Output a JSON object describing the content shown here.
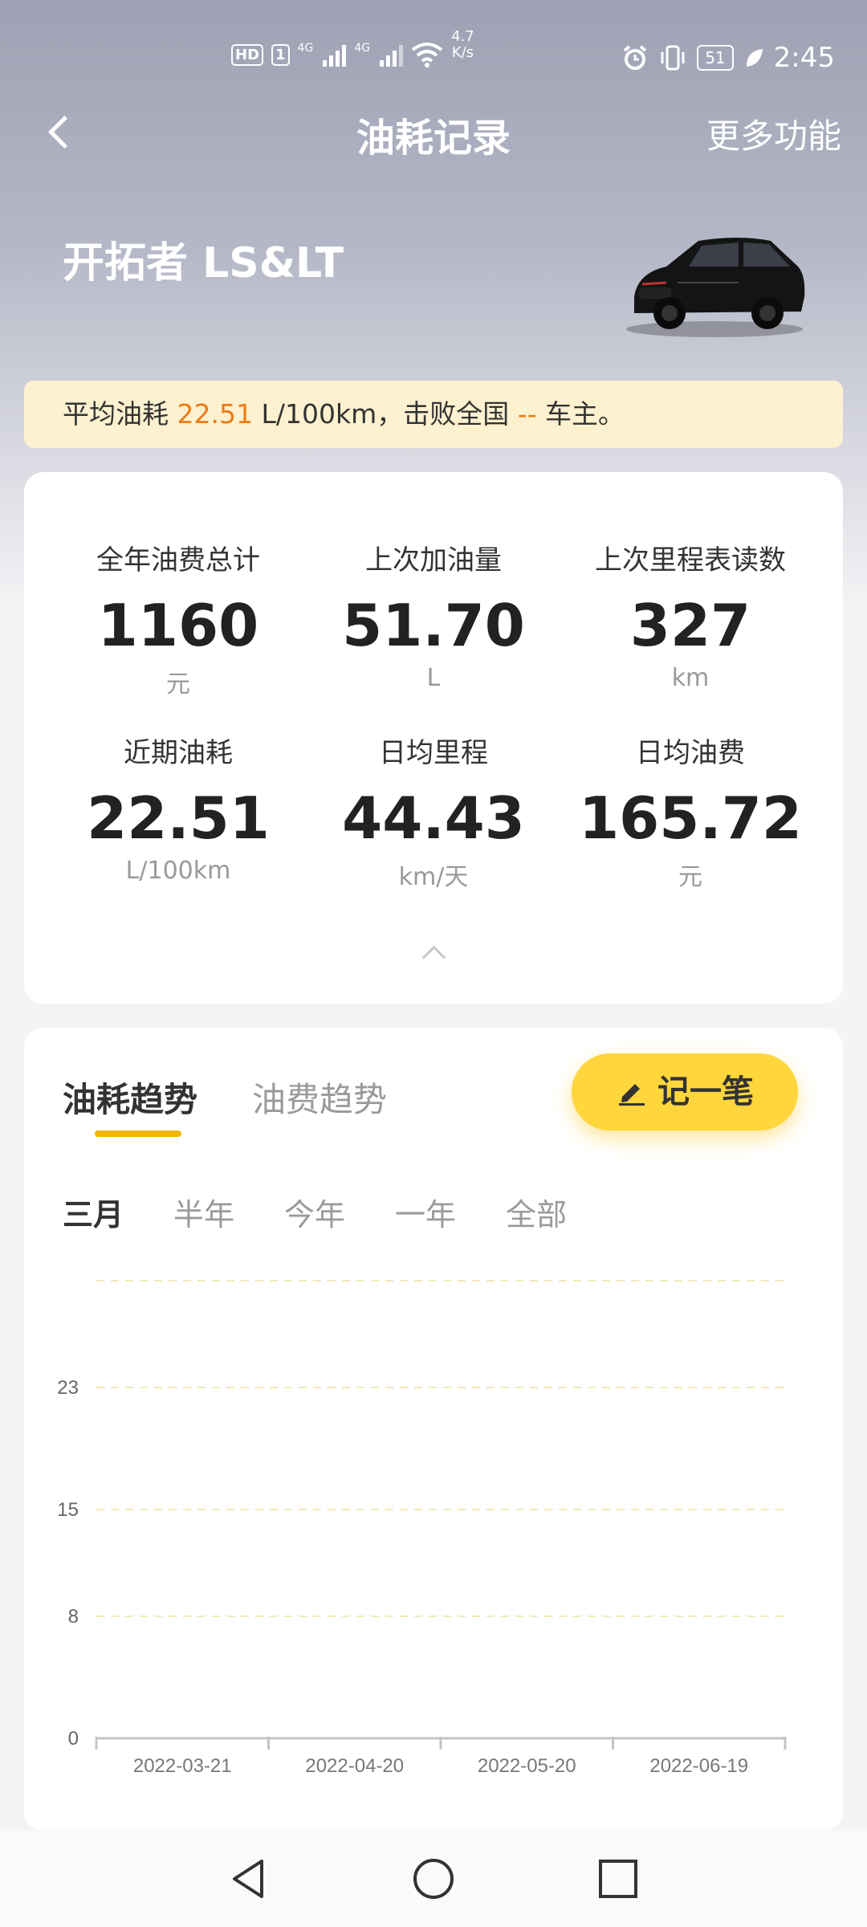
{
  "status_bar": {
    "hd_label": "HD",
    "sim_label": "1",
    "signal_1_label": "4G",
    "signal_2_label": "4G",
    "net_speed_value": "4.7",
    "net_speed_unit": "K/s",
    "battery": "51",
    "time": "2:45"
  },
  "nav": {
    "title": "油耗记录",
    "more_label": "更多功能"
  },
  "car": {
    "name": "开拓者 LS&LT"
  },
  "banner": {
    "prefix": "平均油耗 ",
    "value": "22.51",
    "middle": " L/100km，击败全国 ",
    "rank": "--",
    "suffix": " 车主。"
  },
  "stats": [
    {
      "label": "全年油费总计",
      "value": "1160",
      "unit": "元"
    },
    {
      "label": "上次加油量",
      "value": "51.70",
      "unit": "L"
    },
    {
      "label": "上次里程表读数",
      "value": "327",
      "unit": "km"
    },
    {
      "label": "近期油耗",
      "value": "22.51",
      "unit": "L/100km"
    },
    {
      "label": "日均里程",
      "value": "44.43",
      "unit": "km/天"
    },
    {
      "label": "日均油费",
      "value": "165.72",
      "unit": "元"
    }
  ],
  "tabs": {
    "active": "油耗趋势",
    "inactive": "油费趋势"
  },
  "record_button": "记一笔",
  "ranges": [
    "三月",
    "半年",
    "今年",
    "一年",
    "全部"
  ],
  "colors": {
    "accent": "#ffd63b",
    "highlight": "#ee7b12",
    "grid": "#f3e9b8"
  },
  "chart_data": {
    "type": "line",
    "title": "",
    "xlabel": "",
    "ylabel": "",
    "y_ticks": [
      0,
      8,
      15,
      23
    ],
    "ylim": [
      0,
      30
    ],
    "x_ticks": [
      "2022-03-21",
      "2022-04-20",
      "2022-05-20",
      "2022-06-19"
    ],
    "series": [],
    "grid": true
  }
}
